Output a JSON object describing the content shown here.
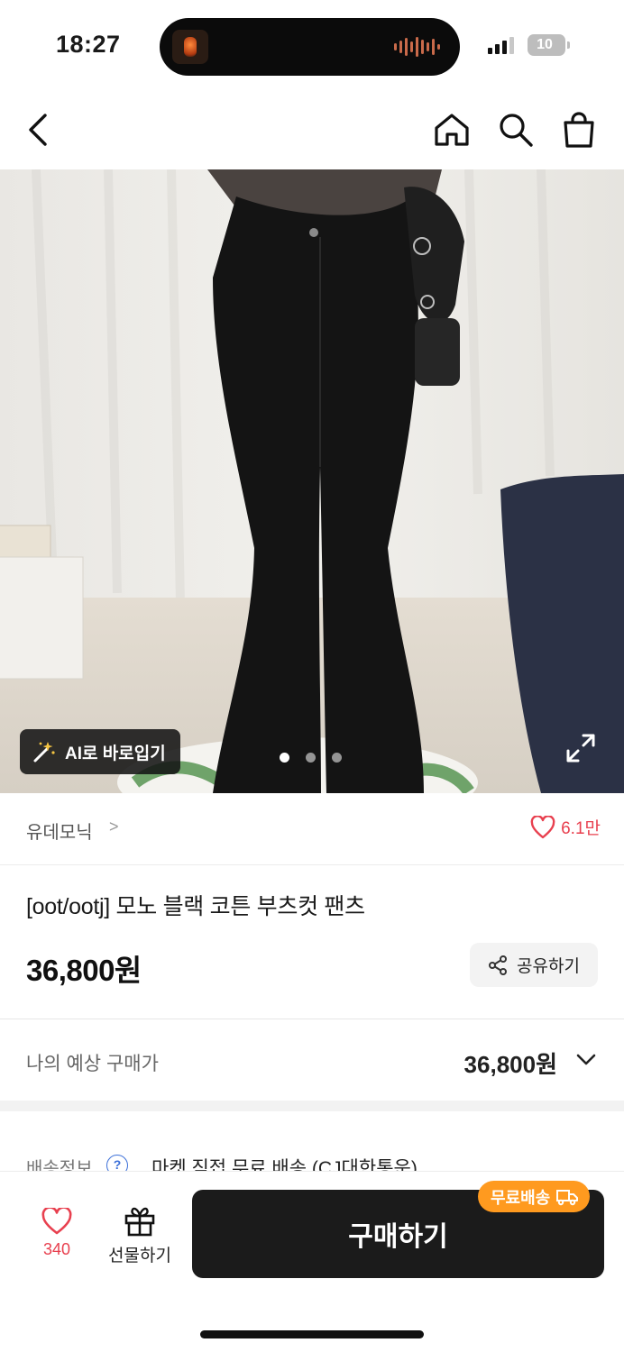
{
  "status_bar": {
    "time": "18:27",
    "battery": "10"
  },
  "nav": {
    "back_icon": "chevron-left-icon",
    "home_icon": "home-icon",
    "search_icon": "search-icon",
    "cart_icon": "shopping-bag-icon"
  },
  "image": {
    "ai_button_label": "AI로 바로입기",
    "slide_count": 3,
    "active_slide": 1
  },
  "brand": {
    "name": "유데모닉",
    "chevron": ">",
    "like_count": "6.1만"
  },
  "product": {
    "title": "[oot/ootj] 모노 블랙 코튼 부츠컷 팬츠",
    "price": "36,800원",
    "share_label": "공유하기"
  },
  "expected": {
    "label": "나의 예상 구매가",
    "price": "36,800원"
  },
  "shipping": {
    "label": "배송정보",
    "help": "?",
    "value": "마켓 직접 무료 배송 (CJ대한통운)"
  },
  "bottom_bar": {
    "wish_count": "340",
    "gift_label": "선물하기",
    "buy_label": "구매하기",
    "free_shipping_badge": "무료배송"
  },
  "colors": {
    "accent_red": "#e8404f",
    "badge_orange": "#ff9a1f",
    "buy_button": "#1b1b1b"
  }
}
